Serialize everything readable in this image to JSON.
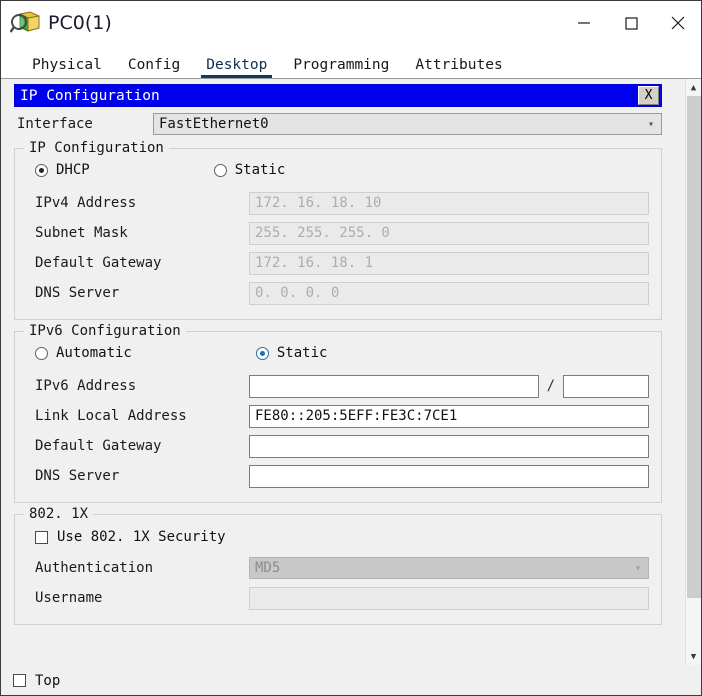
{
  "window": {
    "title": "PC0(1)",
    "icon": "inspect-magnifier-icon",
    "minimize_label": "—",
    "maximize_label": "□",
    "close_label": "✕"
  },
  "tabs": [
    {
      "label": "Physical",
      "active": false
    },
    {
      "label": "Config",
      "active": false
    },
    {
      "label": "Desktop",
      "active": true
    },
    {
      "label": "Programming",
      "active": false
    },
    {
      "label": "Attributes",
      "active": false
    }
  ],
  "inner_window": {
    "title": "IP Configuration",
    "close_label": "X",
    "titlebar_color": "#0000f0"
  },
  "interface": {
    "label": "Interface",
    "value": "FastEthernet0",
    "chevron": "⌄"
  },
  "ipv4": {
    "legend": "IP Configuration",
    "mode_dhcp_label": "DHCP",
    "mode_static_label": "Static",
    "selected_mode": "DHCP",
    "fields": [
      {
        "label": "IPv4 Address",
        "value": "172. 16. 18. 10",
        "disabled": true
      },
      {
        "label": "Subnet Mask",
        "value": "255. 255. 255. 0",
        "disabled": true
      },
      {
        "label": "Default Gateway",
        "value": "172. 16. 18. 1",
        "disabled": true
      },
      {
        "label": "DNS Server",
        "value": "0. 0. 0. 0",
        "disabled": true
      }
    ]
  },
  "ipv6": {
    "legend": "IPv6 Configuration",
    "mode_automatic_label": "Automatic",
    "mode_static_label": "Static",
    "selected_mode": "Static",
    "accent_color": "#1f6fb2",
    "address_label": "IPv6 Address",
    "address_value": "",
    "address_separator": "/",
    "prefix_value": "",
    "link_local_label": "Link Local Address",
    "link_local_value": "FE80::205:5EFF:FE3C:7CE1",
    "gateway_label": "Default Gateway",
    "gateway_value": "",
    "dns_label": "DNS Server",
    "dns_value": ""
  },
  "dot1x": {
    "legend": "802. 1X",
    "use_security_label": "Use 802. 1X Security",
    "use_security_checked": false,
    "authentication_label": "Authentication",
    "authentication_value": "MD5",
    "username_label": "Username",
    "username_value": ""
  },
  "bottom": {
    "top_label": "Top",
    "top_checked": false
  },
  "scrollbar": {
    "up_arrow": "▲",
    "down_arrow": "▼"
  }
}
